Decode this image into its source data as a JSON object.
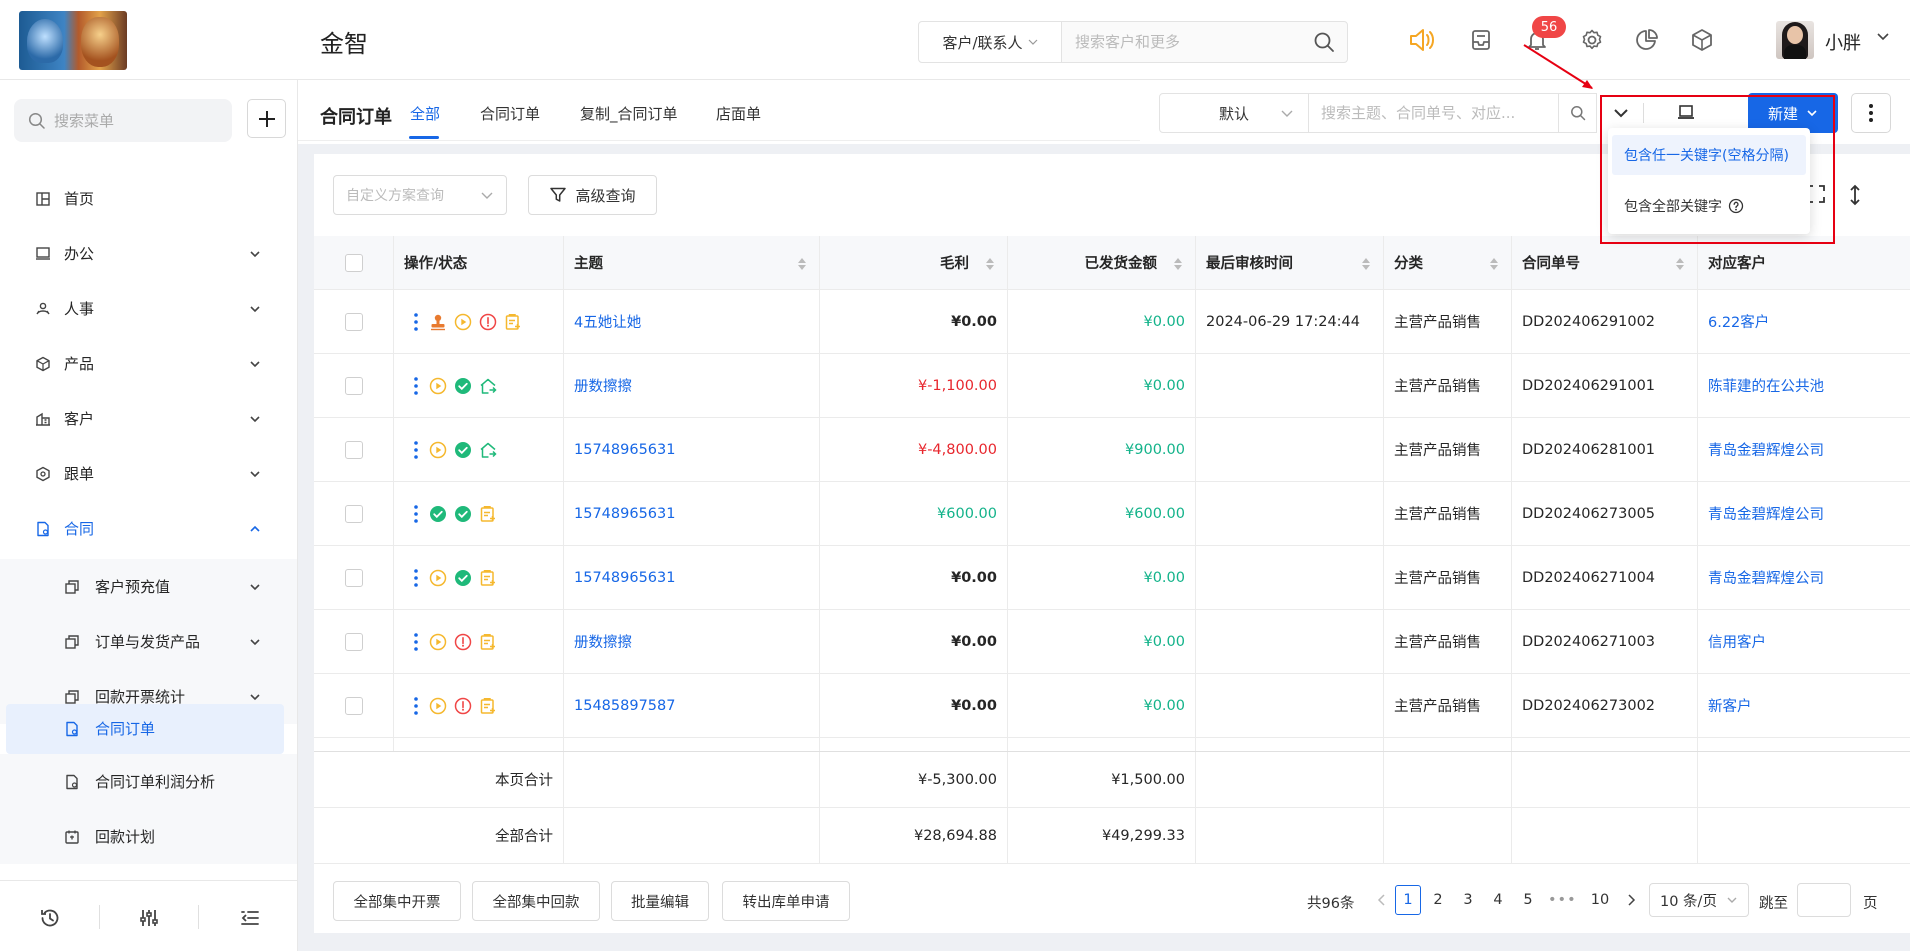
{
  "header": {
    "app_name": "金智",
    "search_type": "客户/联系人",
    "search_placeholder": "搜索客户和更多",
    "notification_count": "56",
    "user_name": "小胖"
  },
  "sidebar": {
    "search_placeholder": "搜索菜单",
    "items": [
      {
        "label": "首页",
        "icon": "home-icon"
      },
      {
        "label": "办公",
        "icon": "office-icon"
      },
      {
        "label": "人事",
        "icon": "hr-icon"
      },
      {
        "label": "产品",
        "icon": "product-icon"
      },
      {
        "label": "客户",
        "icon": "customer-icon"
      },
      {
        "label": "跟单",
        "icon": "follow-icon"
      },
      {
        "label": "合同",
        "icon": "contract-icon"
      }
    ],
    "sub_items": [
      {
        "label": "客户预充值"
      },
      {
        "label": "订单与发货产品"
      },
      {
        "label": "回款开票统计"
      },
      {
        "label": "合同订单"
      },
      {
        "label": "合同订单利润分析"
      },
      {
        "label": "回款计划"
      }
    ]
  },
  "content": {
    "page_title": "合同订单",
    "tabs": [
      "全部",
      "合同订单",
      "复制_合同订单",
      "店面单"
    ],
    "filter_select": "默认",
    "filter_placeholder": "搜索主题、合同单号、对应...",
    "new_button": "新建",
    "keyword_options": [
      "包含任一关键字(空格分隔)",
      "包含全部关键字"
    ]
  },
  "toolbar": {
    "scheme_placeholder": "自定义方案查询",
    "advanced_query": "高级查询"
  },
  "table": {
    "headers": [
      "操作/状态",
      "主题",
      "毛利",
      "已发货金额",
      "最后审核时间",
      "分类",
      "合同单号",
      "对应客户"
    ],
    "rows": [
      {
        "subject": "4五她让她",
        "profit": "¥0.00",
        "shipped": "¥0.00",
        "audit_time": "2024-06-29 17:24:44",
        "category": "主营产品销售",
        "contract_no": "DD202406291002",
        "customer": "6.22客户"
      },
      {
        "subject": "册数擦擦",
        "profit": "¥-1,100.00",
        "shipped": "¥0.00",
        "audit_time": "",
        "category": "主营产品销售",
        "contract_no": "DD202406291001",
        "customer": "陈菲建的在公共池"
      },
      {
        "subject": "15748965631",
        "profit": "¥-4,800.00",
        "shipped": "¥900.00",
        "audit_time": "",
        "category": "主营产品销售",
        "contract_no": "DD202406281001",
        "customer": "青岛金碧辉煌公司"
      },
      {
        "subject": "15748965631",
        "profit": "¥600.00",
        "shipped": "¥600.00",
        "audit_time": "",
        "category": "主营产品销售",
        "contract_no": "DD202406273005",
        "customer": "青岛金碧辉煌公司"
      },
      {
        "subject": "15748965631",
        "profit": "¥0.00",
        "shipped": "¥0.00",
        "audit_time": "",
        "category": "主营产品销售",
        "contract_no": "DD202406271004",
        "customer": "青岛金碧辉煌公司"
      },
      {
        "subject": "册数擦擦",
        "profit": "¥0.00",
        "shipped": "¥0.00",
        "audit_time": "",
        "category": "主营产品销售",
        "contract_no": "DD202406271003",
        "customer": "信用客户"
      },
      {
        "subject": "15485897587",
        "profit": "¥0.00",
        "shipped": "¥0.00",
        "audit_time": "",
        "category": "主营产品销售",
        "contract_no": "DD202406273002",
        "customer": "新客户"
      }
    ],
    "page_total_label": "本页合计",
    "page_total_profit": "¥-5,300.00",
    "page_total_shipped": "¥1,500.00",
    "all_total_label": "全部合计",
    "all_total_profit": "¥28,694.88",
    "all_total_shipped": "¥49,299.33"
  },
  "footer": {
    "buttons": [
      "全部集中开票",
      "全部集中回款",
      "批量编辑",
      "转出库单申请"
    ],
    "total": "共96条",
    "pages": [
      "1",
      "2",
      "3",
      "4",
      "5",
      "10"
    ],
    "ellipsis": "•••",
    "page_size": "10 条/页",
    "jump_label": "跳至",
    "page_unit": "页"
  },
  "colors": {
    "primary": "#1767e6",
    "negative": "#e8262d",
    "positive": "#13b38a",
    "warning": "#f5b82e",
    "danger": "#f04646",
    "success": "#1fb97a",
    "highlight": "#e60012"
  }
}
